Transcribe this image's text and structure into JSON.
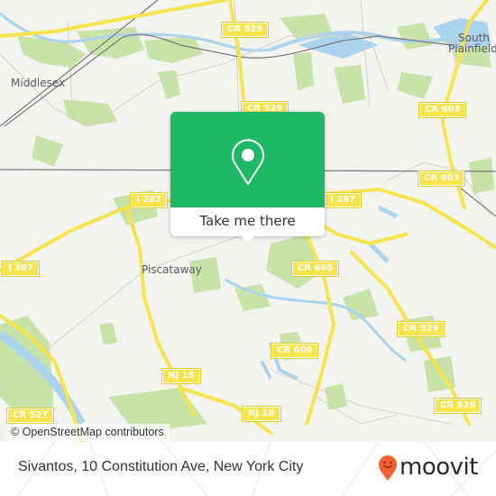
{
  "map": {
    "place_labels": {
      "middlesex": "Middlesex",
      "south": "South",
      "plainfield": "Plainfield",
      "piscataway": "Piscataway"
    },
    "road_shields": {
      "cr529_top": "CR 529",
      "cr529_mid": "CR 529",
      "cr603_top": "CR 603",
      "cr603_mid": "CR 603",
      "i287_left": "I 287",
      "i287_mid": "I 287",
      "i287_right": "I 287",
      "cr665": "CR 665",
      "cr609": "CR 609",
      "nj18_left": "NJ 18",
      "nj18_bottom": "NJ 18",
      "cr529_right1": "CR 529",
      "cr529_right2": "CR 529",
      "cr527": "CR 527"
    },
    "attribution": "© OpenStreetMap contributors",
    "colors": {
      "land": "#f3f3ef",
      "park": "#c8e3a7",
      "water": "#aad3ee",
      "road": "#f7e34b",
      "rail": "#777777"
    }
  },
  "popup": {
    "icon": "location-pin-icon",
    "button_label": "Take me there",
    "color": "#1fb866"
  },
  "footer": {
    "address": "Sivantos, 10 Constitution Ave, New York City",
    "brand": "moovit",
    "brand_color": "#f2612f"
  }
}
